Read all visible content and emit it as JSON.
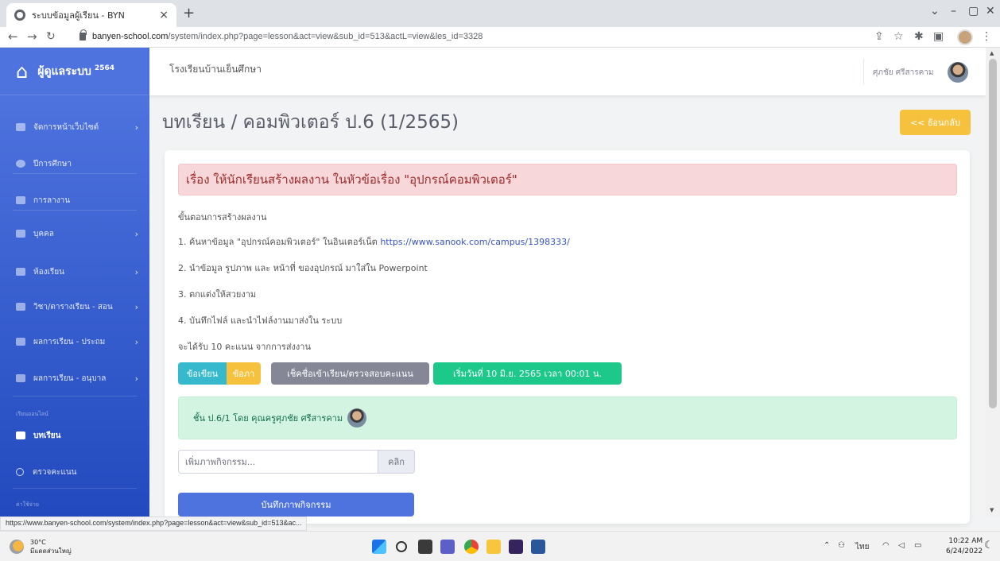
{
  "browser": {
    "tab_title": "ระบบข้อมูลผู้เรียน - BYN",
    "tab_close": "×",
    "new_tab": "+",
    "url_host": "banyen-school.com",
    "url_path": "/system/index.php?page=lesson&act=view&sub_id=513&actL=view&les_id=3328",
    "status_url": "https://www.banyen-school.com/system/index.php?page=lesson&act=view&sub_id=513&ac..."
  },
  "sidebar": {
    "brand": "ผู้ดูแลระบบ",
    "year": "2564",
    "items": [
      {
        "label": "จัดการหน้าเว็บไซต์"
      },
      {
        "label": "ปีการศึกษา"
      },
      {
        "label": "การลางาน"
      },
      {
        "label": "บุคคล"
      },
      {
        "label": "ห้องเรียน"
      },
      {
        "label": "วิชา/ตารางเรียน - สอน"
      },
      {
        "label": "ผลการเรียน - ประถม"
      },
      {
        "label": "ผลการเรียน - อนุบาล"
      }
    ],
    "section_online": "เรียนออนไลน์",
    "lesson": "บทเรียน",
    "check_scores": "ตรวจคะแนน",
    "section_expense": "ค่าใช้จ่าย"
  },
  "topbar": {
    "school": "โรงเรียนบ้านเย็นศึกษา",
    "user": "ศุภชัย ศรีสารคาม"
  },
  "page": {
    "title": "บทเรียน / คอมพิวเตอร์ ป.6 (1/2565)",
    "back": "<< ย้อนกลับ"
  },
  "lesson": {
    "topic": "เรื่อง ให้นักเรียนสร้างผลงาน ในหัวข้อเรื่อง \"อุปกรณ์คอมพิวเตอร์\"",
    "steps_heading": "ขั้นตอนการสร้างผลงาน",
    "step1_text": "1. ค้นหาข้อมูล \"อุปกรณ์คอมพิวเตอร์\" ในอินเตอร์เน็ต",
    "step1_link": "https://www.sanook.com/campus/1398333/",
    "step2": "2. นำข้อมูล รูปภาพ และ หน้าที่ ของอุปกรณ์ มาใส่ใน Powerpoint",
    "step3": "3. ตกแต่งให้สวยงาม",
    "step4": "4. บันทึกไฟล์ และนำไฟล์งานมาส่งใน ระบบ",
    "score_note": "จะได้รับ 10 คะแนน จากการส่งงาน",
    "type1": "ข้อเขียน",
    "type2": "ข้อภา",
    "check_btn": "เช็คชื่อเข้าเรียน/ตรวจสอบคะแนน",
    "start_date": "เริ่มวันที่ 10 มิ.ย. 2565 เวลา 00:01 น.",
    "class_info": "ชั้น ป.6/1 โดย คุณครูศุภชัย ศรีสารคาม",
    "activity_placeholder": "เพิ่มภาพกิจกรรม...",
    "click": "คลิก",
    "save": "บันทึกภาพกิจกรรม"
  },
  "taskbar": {
    "temp": "30°C",
    "weather": "มีแดดส่วนใหญ่",
    "lang": "ไทย",
    "time": "10:22 AM",
    "date": "6/24/2022"
  }
}
